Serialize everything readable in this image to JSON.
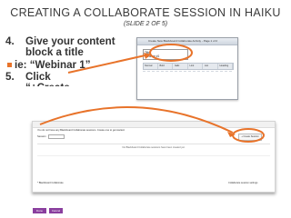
{
  "slide": {
    "title": "CREATING A COLLABORATE SESSION IN HAIKU",
    "subtitle": "(SLIDE 2 OF 5)"
  },
  "bullets": {
    "step4_num": "4.",
    "step4_text": "Give your content block a title",
    "example_text": "ie: “Webinar 1”",
    "step5_num": "5.",
    "step5_text": "Click",
    "step5_cut": "“+Create"
  },
  "dialog": {
    "bar_title": "Create New Blackboard Collaborate Activity - Page 1 of 2",
    "field_label": "Title",
    "field_value": "Webinar #1",
    "tabs": [
      "Normal",
      "Bold",
      "Italic",
      "Link",
      "List",
      "Heading"
    ]
  },
  "screenshot": {
    "intro": "You do not have any Blackboard Collaborate sessions. Create one to get started.",
    "row_label": "Session",
    "create_button": "+ Create Session",
    "empty": "No Blackboard Collaborate sessions have been created yet.",
    "footer_left": "* Blackboard Collaborate",
    "footer_right": "Collaborate session settings"
  },
  "buttons": [
    "Done",
    "Cancel"
  ],
  "colors": {
    "accent": "#e8732a",
    "purple": "#8a3f9e"
  }
}
